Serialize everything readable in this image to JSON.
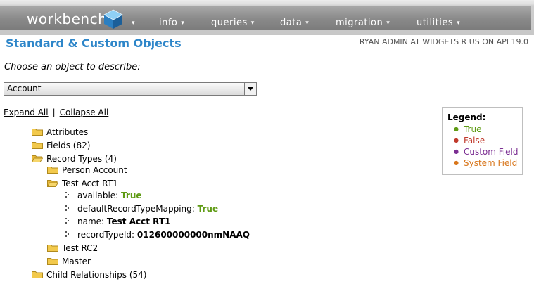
{
  "nav": {
    "logo_text": "workbench",
    "items": [
      {
        "label": "info"
      },
      {
        "label": "queries"
      },
      {
        "label": "data"
      },
      {
        "label": "migration"
      },
      {
        "label": "utilities"
      }
    ]
  },
  "page": {
    "title": "Standard & Custom Objects",
    "user_info": "RYAN ADMIN AT WIDGETS R US ON API 19.0",
    "prompt": "Choose an object to describe:",
    "selected_object": "Account",
    "expand_all": "Expand All",
    "separator": "|",
    "collapse_all": "Collapse All"
  },
  "legend": {
    "heading": "Legend:",
    "true": "True",
    "false": "False",
    "custom": "Custom Field",
    "system": "System Field"
  },
  "tree": {
    "attributes": "Attributes",
    "fields": "Fields (82)",
    "record_types": "Record Types (4)",
    "person_account": "Person Account",
    "test_acct": "Test Acct RT1",
    "available_key": "available:",
    "available_val": "True",
    "default_key": "defaultRecordTypeMapping:",
    "default_val": "True",
    "name_key": "name:",
    "name_val": "Test Acct RT1",
    "rtid_key": "recordTypeId:",
    "rtid_val": "012600000000nmNAAQ",
    "test_rc2": "Test RC2",
    "master": "Master",
    "child_rel": "Child Relationships (54)"
  },
  "colors": {
    "title_blue": "#2e86c9",
    "true_green": "#5f9b14",
    "false_red": "#c0392b",
    "custom_purple": "#7b2e92",
    "system_orange": "#d8761b",
    "folder_yellow": "#f2c94c"
  }
}
